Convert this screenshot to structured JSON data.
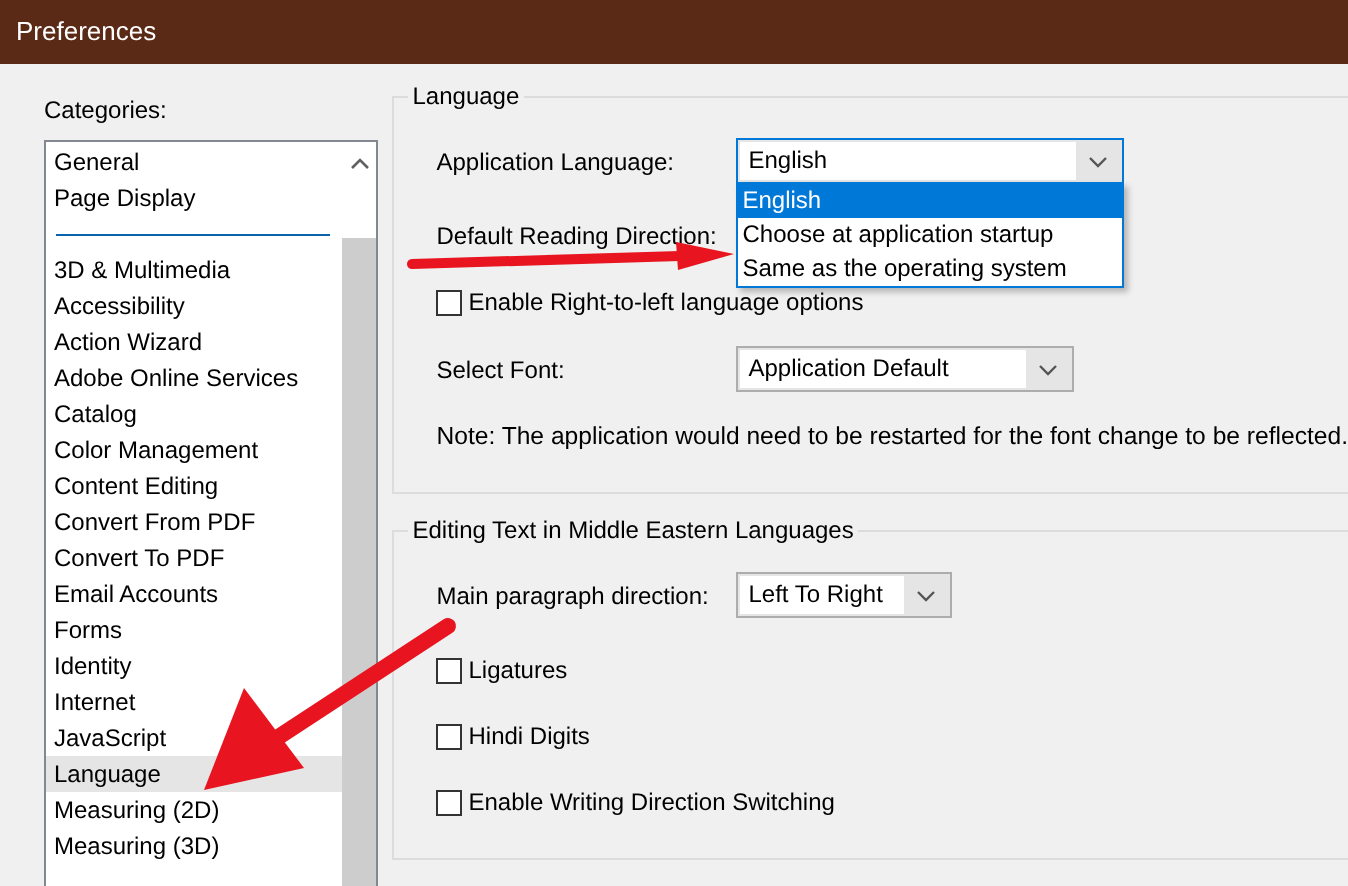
{
  "window": {
    "title": "Preferences"
  },
  "categories": {
    "label": "Categories:",
    "items": [
      {
        "kind": "item",
        "label": "General",
        "selected": false
      },
      {
        "kind": "item",
        "label": "Page Display",
        "selected": false
      },
      {
        "kind": "separator"
      },
      {
        "kind": "item",
        "label": "3D & Multimedia",
        "selected": false
      },
      {
        "kind": "item",
        "label": "Accessibility",
        "selected": false
      },
      {
        "kind": "item",
        "label": "Action Wizard",
        "selected": false
      },
      {
        "kind": "item",
        "label": "Adobe Online Services",
        "selected": false
      },
      {
        "kind": "item",
        "label": "Catalog",
        "selected": false
      },
      {
        "kind": "item",
        "label": "Color Management",
        "selected": false
      },
      {
        "kind": "item",
        "label": "Content Editing",
        "selected": false
      },
      {
        "kind": "item",
        "label": "Convert From PDF",
        "selected": false
      },
      {
        "kind": "item",
        "label": "Convert To PDF",
        "selected": false
      },
      {
        "kind": "item",
        "label": "Email Accounts",
        "selected": false
      },
      {
        "kind": "item",
        "label": "Forms",
        "selected": false
      },
      {
        "kind": "item",
        "label": "Identity",
        "selected": false
      },
      {
        "kind": "item",
        "label": "Internet",
        "selected": false
      },
      {
        "kind": "item",
        "label": "JavaScript",
        "selected": false
      },
      {
        "kind": "item",
        "label": "Language",
        "selected": true
      },
      {
        "kind": "item",
        "label": "Measuring (2D)",
        "selected": false
      },
      {
        "kind": "item",
        "label": "Measuring (3D)",
        "selected": false
      }
    ]
  },
  "groups": [
    {
      "title": "Language",
      "rows": [
        {
          "kind": "select",
          "label": "Application Language:",
          "value": "English",
          "expanded": true,
          "options": [
            {
              "label": "English",
              "selected": true
            },
            {
              "label": "Choose at application startup",
              "selected": false
            },
            {
              "label": "Same as the operating system",
              "selected": false
            }
          ]
        },
        {
          "kind": "label",
          "label": "Default Reading Direction:"
        },
        {
          "kind": "checkbox",
          "label": "Enable Right-to-left language options",
          "checked": false
        },
        {
          "kind": "select",
          "label": "Select Font:",
          "value": "Application Default"
        },
        {
          "kind": "note",
          "label": "Note: The application would need to be restarted for the font change to be reflected."
        }
      ]
    },
    {
      "title": "Editing Text in Middle Eastern Languages",
      "rows": [
        {
          "kind": "select",
          "label": "Main paragraph direction:",
          "value": "Left To Right"
        },
        {
          "kind": "checkbox",
          "label": "Ligatures",
          "checked": false
        },
        {
          "kind": "checkbox",
          "label": "Hindi Digits",
          "checked": false
        },
        {
          "kind": "checkbox",
          "label": "Enable Writing Direction Switching",
          "checked": false
        }
      ]
    }
  ]
}
